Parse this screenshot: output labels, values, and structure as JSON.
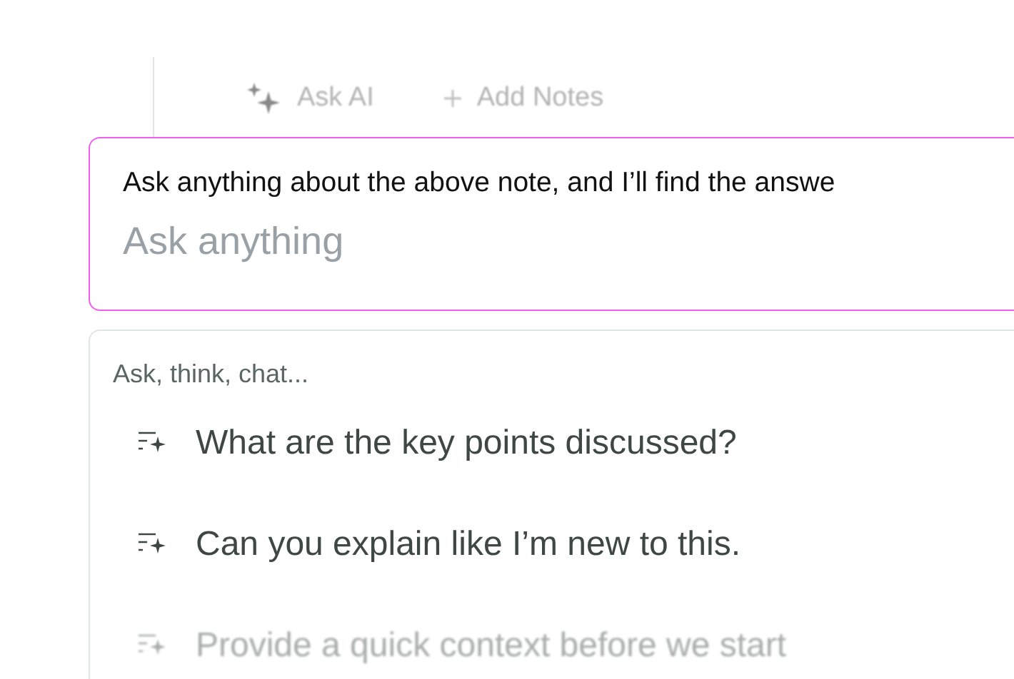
{
  "toolbar": [
    {
      "kind": "ai",
      "label": "Ask AI"
    },
    {
      "kind": "add",
      "label": "Add Notes"
    }
  ],
  "ask_box": {
    "prompt": "Ask anything about the above note, and I’ll find the answe",
    "placeholder": "Ask anything"
  },
  "suggestions": {
    "header": "Ask, think, chat...",
    "items": [
      {
        "label": "What are the key points discussed?",
        "dimmed": false
      },
      {
        "label": "Can you explain like I’m new to this.",
        "dimmed": false
      },
      {
        "label": "Provide a quick context before we start",
        "dimmed": true
      }
    ]
  }
}
